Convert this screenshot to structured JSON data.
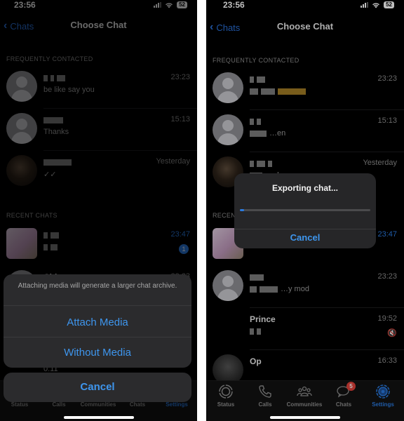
{
  "left_screen": {
    "status_bar": {
      "time": "23:56",
      "battery": "52"
    },
    "nav": {
      "back_label": "Chats",
      "title": "Choose Chat"
    },
    "sections": {
      "frequent": "FREQUENTLY CONTACTED",
      "recent": "RECENT CHATS"
    },
    "frequent_chats": [
      {
        "message": "be like say you",
        "time": "23:23"
      },
      {
        "message": "Thanks",
        "time": "15:13"
      },
      {
        "message": "✓✓",
        "time": "Yesterday"
      }
    ],
    "recent_chats": [
      {
        "time": "23:47",
        "unread": "1"
      },
      {
        "name": "Chi",
        "time": "23:23"
      },
      {
        "message": "0:11"
      }
    ],
    "action_sheet": {
      "message": "Attaching media will generate a larger chat archive.",
      "attach_media": "Attach Media",
      "without_media": "Without Media",
      "cancel": "Cancel"
    },
    "tabs": [
      "Status",
      "Calls",
      "Communities",
      "Chats",
      "Settings"
    ]
  },
  "right_screen": {
    "status_bar": {
      "time": "23:56",
      "battery": "52"
    },
    "nav": {
      "back_label": "Chats",
      "title": "Choose Chat"
    },
    "sections": {
      "frequent": "FREQUENTLY CONTACTED",
      "recent": "RECENT CHATS"
    },
    "frequent_chats": [
      {
        "time": "23:23"
      },
      {
        "message": "…en",
        "time": "15:13"
      },
      {
        "message": "…ah",
        "time": "Yesterday"
      }
    ],
    "recent_chats": [
      {
        "time": "23:47"
      },
      {
        "message": "…y mod",
        "time": "23:23"
      },
      {
        "name": "Prince",
        "time": "19:52",
        "muted": true
      },
      {
        "name": "Op",
        "time": "16:33"
      }
    ],
    "export_alert": {
      "title": "Exporting chat...",
      "progress_percent": 3,
      "cancel": "Cancel"
    },
    "tabs": [
      {
        "label": "Status",
        "icon": "status-icon"
      },
      {
        "label": "Calls",
        "icon": "phone-icon"
      },
      {
        "label": "Communities",
        "icon": "communities-icon"
      },
      {
        "label": "Chats",
        "icon": "chat-bubbles-icon",
        "badge": "5"
      },
      {
        "label": "Settings",
        "icon": "gear-icon",
        "active": true
      }
    ]
  },
  "colors": {
    "accent": "#2a7ae0",
    "badge": "#e0403a",
    "background": "#000000",
    "sheet": "#2b2b2d"
  }
}
